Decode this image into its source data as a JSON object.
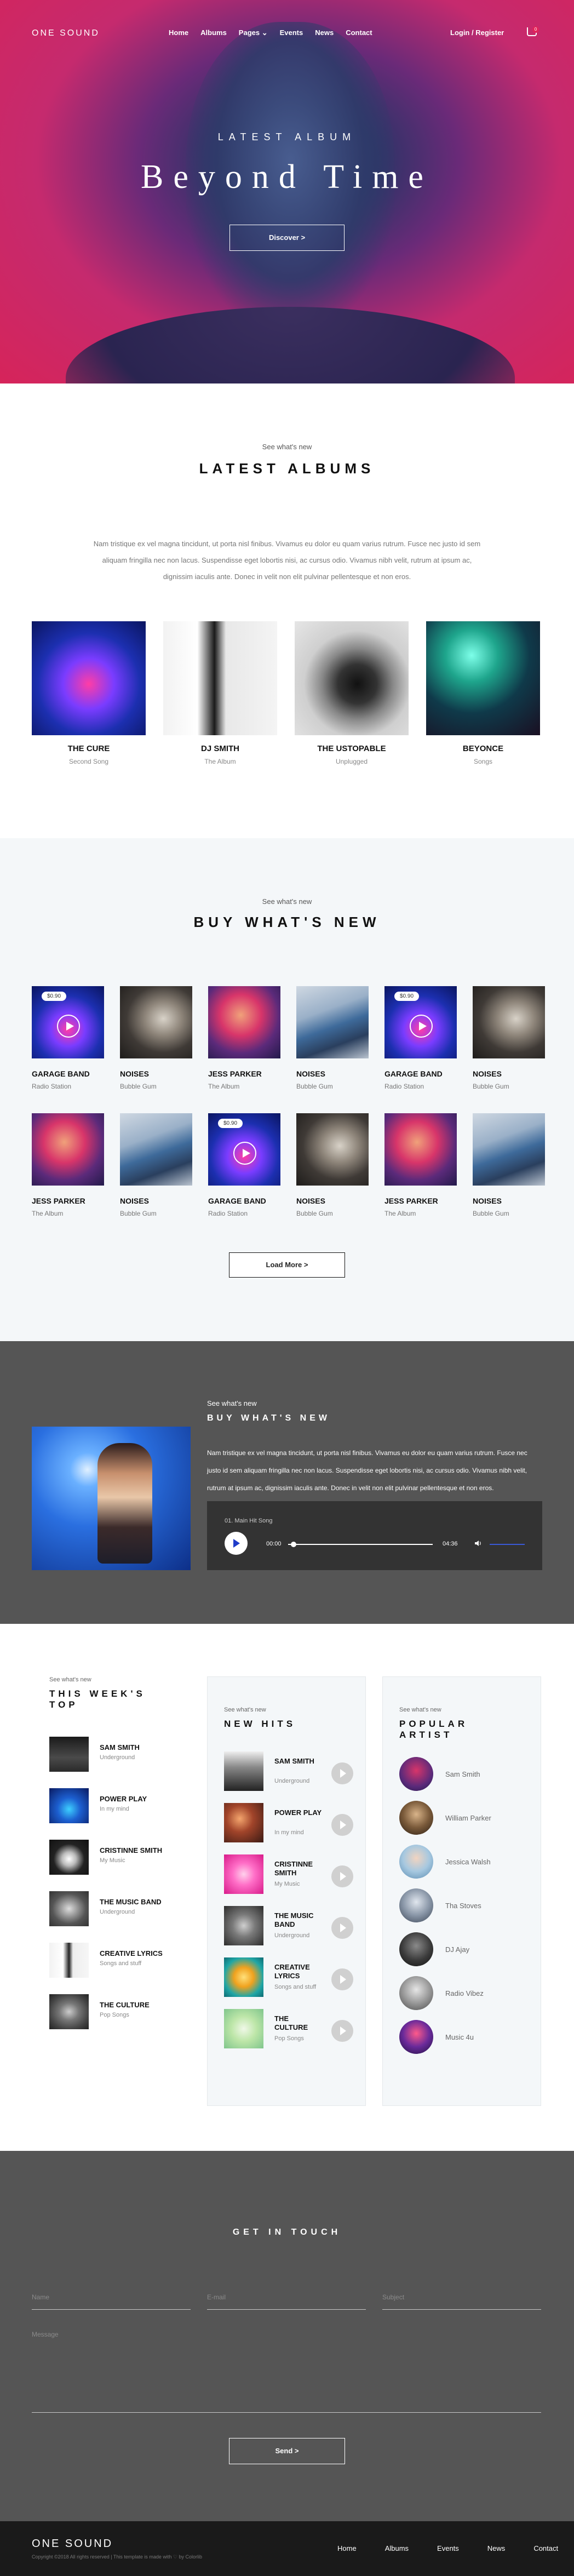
{
  "nav": {
    "logo": "ONE SOUND",
    "items": [
      "Home",
      "Albums",
      "Pages ⌄",
      "Events",
      "News",
      "Contact"
    ],
    "login": "Login / Register",
    "cart_count": "0"
  },
  "hero": {
    "eyebrow": "LATEST ALBUM",
    "title": "Beyond Time",
    "button": "Discover  >"
  },
  "albums": {
    "eyebrow": "See what's new",
    "title": "LATEST ALBUMS",
    "desc": "Nam tristique ex vel magna tincidunt, ut porta nisl finibus. Vivamus eu dolor eu quam varius rutrum. Fusce nec justo id sem aliquam fringilla nec non lacus. Suspendisse eget lobortis nisi, ac cursus odio. Vivamus nibh velit, rutrum at ipsum ac, dignissim iaculis ante. Donec in velit non elit pulvinar pellentesque et non eros.",
    "items": [
      {
        "title": "THE CURE",
        "sub": "Second Song"
      },
      {
        "title": "DJ SMITH",
        "sub": "The Album"
      },
      {
        "title": "THE USTOPABLE",
        "sub": "Unplugged"
      },
      {
        "title": "BEYONCE",
        "sub": "Songs"
      }
    ]
  },
  "buy": {
    "eyebrow": "See what's new",
    "title": "BUY WHAT'S NEW",
    "load_more": "Load More  >",
    "items": [
      {
        "title": "GARAGE BAND",
        "sub": "Radio Station",
        "price": "$0.90"
      },
      {
        "title": "NOISES",
        "sub": "Bubble Gum",
        "price": ""
      },
      {
        "title": "JESS PARKER",
        "sub": "The Album",
        "price": ""
      },
      {
        "title": "NOISES",
        "sub": "Bubble Gum",
        "price": ""
      },
      {
        "title": "GARAGE BAND",
        "sub": "Radio Station",
        "price": "$0.90"
      },
      {
        "title": "NOISES",
        "sub": "Bubble Gum",
        "price": ""
      },
      {
        "title": "JESS PARKER",
        "sub": "The Album",
        "price": ""
      },
      {
        "title": "NOISES",
        "sub": "Bubble Gum",
        "price": ""
      },
      {
        "title": "GARAGE BAND",
        "sub": "Radio Station",
        "price": "$0.90"
      },
      {
        "title": "NOISES",
        "sub": "Bubble Gum",
        "price": ""
      },
      {
        "title": "JESS PARKER",
        "sub": "The Album",
        "price": ""
      },
      {
        "title": "NOISES",
        "sub": "Bubble Gum",
        "price": ""
      }
    ]
  },
  "feature": {
    "eyebrow": "See what's new",
    "title": "BUY WHAT'S NEW",
    "desc": "Nam tristique ex vel magna tincidunt, ut porta nisl finibus. Vivamus eu dolor eu quam varius rutrum. Fusce nec justo id sem aliquam fringilla nec non lacus. Suspendisse eget lobortis nisi, ac cursus odio. Vivamus nibh velit, rutrum at ipsum ac, dignissim iaculis ante. Donec in velit non elit pulvinar pellentesque et non eros.",
    "player": {
      "song": "01. Main Hit Song",
      "current": "00:00",
      "duration": "04:36",
      "progress": 0.02
    }
  },
  "week": {
    "eyebrow": "See what's new",
    "title": "THIS WEEK'S TOP",
    "items": [
      {
        "title": "SAM SMITH",
        "sub": "Underground"
      },
      {
        "title": "POWER PLAY",
        "sub": "In my mind"
      },
      {
        "title": "CRISTINNE SMITH",
        "sub": "My Music"
      },
      {
        "title": "THE MUSIC BAND",
        "sub": "Underground"
      },
      {
        "title": "CREATIVE LYRICS",
        "sub": "Songs and stuff"
      },
      {
        "title": "THE CULTURE",
        "sub": "Pop Songs"
      }
    ]
  },
  "hits": {
    "eyebrow": "See what's new",
    "title": "NEW HITS",
    "items": [
      {
        "title": "SAM SMITH",
        "sub": "Underground"
      },
      {
        "title": "POWER PLAY",
        "sub": "In my mind"
      },
      {
        "title": "CRISTINNE SMITH",
        "sub": "My Music"
      },
      {
        "title": "THE MUSIC BAND",
        "sub": "Underground"
      },
      {
        "title": "CREATIVE LYRICS",
        "sub": "Songs and stuff"
      },
      {
        "title": "THE CULTURE",
        "sub": "Pop Songs"
      }
    ]
  },
  "artists": {
    "eyebrow": "See what's new",
    "title": "POPULAR ARTIST",
    "items": [
      "Sam Smith",
      "William Parker",
      "Jessica Walsh",
      "Tha Stoves",
      "DJ Ajay",
      "Radio Vibez",
      "Music 4u"
    ]
  },
  "contact": {
    "title": "GET IN TOUCH",
    "name_ph": "Name",
    "email_ph": "E-mail",
    "subject_ph": "Subject",
    "message_ph": "Message",
    "send": "Send  >"
  },
  "footer": {
    "logo": "ONE SOUND",
    "copyright": "Copyright ©2018 All rights reserved | This template is made with ♡ by Colorlib",
    "items": [
      "Home",
      "Albums",
      "Events",
      "News",
      "Contact"
    ]
  }
}
